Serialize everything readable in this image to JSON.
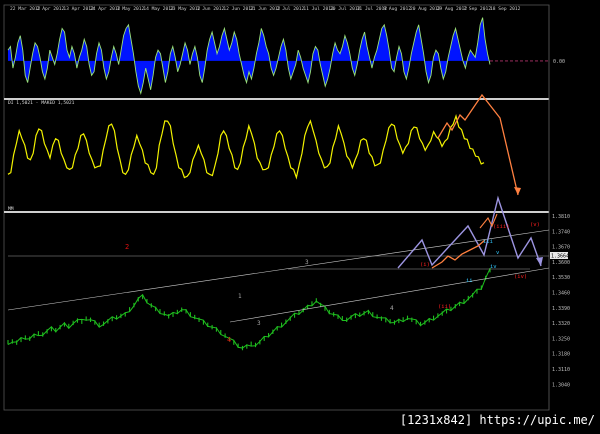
{
  "watermark": "[1231x842] https://upic.me/",
  "colors": {
    "background": "#000000",
    "histogram": "#0014ff",
    "histogram_outline": "#9be37a",
    "oscillator": "#f2f200",
    "price": "#1fbf1f",
    "projection_orange": "#ff8040",
    "projection_violet": "#9c94e0",
    "wave_red": "#e01010",
    "label_cyan": "#33c8ff"
  },
  "panel_labels": {
    "panel2": "DI 1,5021 - MAKED 1,5021",
    "panel3": "MM"
  },
  "chart_data": [
    {
      "type": "area",
      "name": "histogram-oscillator",
      "y_zero_label": "0.00",
      "series": [
        {
          "values": [
            0.3,
            0.4,
            -0.2,
            0.1,
            0.5,
            0.7,
            0.3,
            -0.4,
            -0.6,
            -0.2,
            0.2,
            0.5,
            0.4,
            0.1,
            -0.3,
            -0.5,
            -0.2,
            0.3,
            0.1,
            -0.1,
            0.2,
            0.6,
            0.9,
            0.8,
            0.3,
            0.1,
            0.4,
            0.2,
            -0.2,
            0.1,
            0.3,
            0.6,
            0.4,
            -0.1,
            -0.4,
            -0.3,
            0.2,
            0.5,
            0.3,
            -0.2,
            -0.5,
            -0.3,
            0.1,
            0.4,
            0.2,
            -0.1,
            0.3,
            0.7,
            0.9,
            1.0,
            0.6,
            0.2,
            -0.3,
            -0.7,
            -0.9,
            -0.6,
            -0.2,
            -0.5,
            -0.8,
            -0.4,
            0.1,
            0.3,
            0.2,
            -0.2,
            -0.6,
            -0.3,
            0.2,
            0.4,
            0.1,
            -0.3,
            -0.1,
            0.2,
            0.5,
            0.3,
            -0.1,
            0.2,
            0.4,
            0.1,
            -0.4,
            -0.6,
            -0.2,
            0.3,
            0.6,
            0.8,
            0.5,
            0.2,
            0.4,
            0.7,
            0.9,
            0.6,
            0.3,
            0.5,
            0.8,
            0.6,
            0.2,
            -0.1,
            -0.4,
            -0.6,
            -0.3,
            -0.5,
            -0.2,
            0.2,
            0.5,
            0.9,
            0.7,
            0.4,
            0.2,
            -0.2,
            -0.4,
            -0.2,
            0.1,
            0.4,
            0.6,
            0.3,
            -0.2,
            -0.5,
            -0.3,
            -0.1,
            0.3,
            0.1,
            -0.2,
            -0.4,
            -0.6,
            -0.3,
            0.2,
            0.4,
            0.3,
            -0.1,
            -0.4,
            -0.7,
            -0.5,
            -0.2,
            0.2,
            0.5,
            0.3,
            0.2,
            0.4,
            0.7,
            0.5,
            0.2,
            -0.2,
            -0.4,
            -0.1,
            0.3,
            0.6,
            0.8,
            0.4,
            0.1,
            -0.2,
            0.1,
            0.3,
            0.6,
            0.9,
            1.0,
            0.7,
            0.3,
            -0.2,
            -0.3,
            0.1,
            0.4,
            0.2,
            -0.3,
            -0.5,
            -0.2,
            0.2,
            0.5,
            0.8,
            1.0,
            0.6,
            0.2,
            -0.3,
            -0.6,
            -0.4,
            0.1,
            0.3,
            0.2,
            -0.2,
            -0.5,
            -0.3,
            0.1,
            0.4,
            0.7,
            0.9,
            0.6,
            0.3,
            0.0,
            -0.2,
            0.1,
            0.3,
            0.2,
            0.1,
            0.5,
            1.0,
            1.2,
            0.6,
            0.2,
            -0.1
          ]
        }
      ],
      "ylim": [
        -1.0,
        1.3
      ]
    },
    {
      "type": "line",
      "name": "yellow-oscillator",
      "series": [
        {
          "values": [
            30,
            35,
            50,
            65,
            75,
            70,
            60,
            50,
            45,
            55,
            70,
            80,
            75,
            65,
            55,
            50,
            60,
            70,
            65,
            55,
            45,
            40,
            35,
            40,
            50,
            60,
            70,
            75,
            65,
            55,
            45,
            40,
            38,
            42,
            55,
            70,
            80,
            85,
            75,
            60,
            45,
            35,
            30,
            38,
            50,
            62,
            70,
            65,
            55,
            45,
            40,
            35,
            30,
            40,
            60,
            75,
            85,
            88,
            80,
            65,
            50,
            40,
            35,
            30,
            28,
            35,
            45,
            55,
            60,
            55,
            45,
            35,
            30,
            32,
            40,
            55,
            70,
            78,
            70,
            60,
            50,
            40,
            35,
            45,
            58,
            70,
            80,
            75,
            62,
            50,
            42,
            38,
            35,
            40,
            50,
            62,
            72,
            78,
            70,
            60,
            48,
            40,
            35,
            30,
            40,
            55,
            70,
            82,
            85,
            78,
            65,
            55,
            45,
            40,
            38,
            45,
            58,
            70,
            80,
            75,
            62,
            52,
            45,
            40,
            45,
            55,
            65,
            70,
            65,
            55,
            48,
            42,
            40,
            45,
            55,
            68,
            78,
            85,
            80,
            70,
            60,
            55,
            58,
            65,
            75,
            82,
            78,
            70,
            62,
            58,
            60,
            68,
            74,
            72,
            66,
            62,
            64,
            70,
            78,
            85,
            90,
            82,
            76,
            70,
            66,
            60,
            56,
            52,
            48,
            44,
            42
          ]
        }
      ],
      "ylim": [
        0,
        100
      ]
    },
    {
      "type": "line",
      "name": "price-chart",
      "y_tick_labels": [
        "1.3810",
        "1.3740",
        "1.3670",
        "1.3600",
        "1.3530",
        "1.3460",
        "1.3390",
        "1.3320",
        "1.3250",
        "1.3180",
        "1.3110",
        "1.3040"
      ],
      "last_price_label": "1.3664",
      "series": [
        {
          "values": [
            1.3228,
            1.3232,
            1.3226,
            1.324,
            1.3252,
            1.3246,
            1.3262,
            1.3274,
            1.3268,
            1.3284,
            1.3296,
            1.329,
            1.3306,
            1.332,
            1.3312,
            1.3328,
            1.334,
            1.3334,
            1.335,
            1.3344,
            1.333,
            1.3318,
            1.3324,
            1.3336,
            1.3348,
            1.3356,
            1.3364,
            1.3372,
            1.3398,
            1.342,
            1.345,
            1.3462,
            1.344,
            1.3418,
            1.34,
            1.3388,
            1.3376,
            1.3362,
            1.337,
            1.3384,
            1.3396,
            1.3388,
            1.3372,
            1.3358,
            1.3344,
            1.333,
            1.3318,
            1.3306,
            1.3294,
            1.328,
            1.3262,
            1.3244,
            1.3226,
            1.321,
            1.3198,
            1.3206,
            1.322,
            1.3214,
            1.3228,
            1.3246,
            1.3264,
            1.3282,
            1.33,
            1.3318,
            1.3334,
            1.335,
            1.3366,
            1.338,
            1.3394,
            1.341,
            1.3428,
            1.3444,
            1.342,
            1.3402,
            1.3384,
            1.3372,
            1.336,
            1.3352,
            1.3344,
            1.3356,
            1.3364,
            1.337,
            1.3378,
            1.3384,
            1.3372,
            1.336,
            1.335,
            1.3342,
            1.3336,
            1.333,
            1.3338,
            1.3346,
            1.3354,
            1.3344,
            1.3332,
            1.3322,
            1.333,
            1.3342,
            1.3354,
            1.3366,
            1.3376,
            1.3388,
            1.34,
            1.3414,
            1.3426,
            1.344,
            1.3456,
            1.347,
            1.349,
            1.351,
            1.356,
            1.36
          ]
        }
      ],
      "wave_labels": [
        {
          "text": "2",
          "color": "red"
        },
        {
          "text": "3",
          "color": "gray"
        },
        {
          "text": "1",
          "color": "gray"
        },
        {
          "text": "3",
          "color": "gray"
        },
        {
          "text": "4",
          "color": "red"
        },
        {
          "text": "4",
          "color": "gray"
        },
        {
          "text": "(i)",
          "color": "red"
        },
        {
          "text": "(ii)",
          "color": "red"
        },
        {
          "text": "iii",
          "color": "cyan"
        },
        {
          "text": "v",
          "color": "cyan"
        },
        {
          "text": "iv",
          "color": "cyan"
        },
        {
          "text": "ii",
          "color": "cyan"
        },
        {
          "text": "(iii)",
          "color": "red"
        },
        {
          "text": "(iv)",
          "color": "red"
        },
        {
          "text": "(v)",
          "color": "red"
        }
      ]
    }
  ],
  "x_axis_dates": [
    "22 Mar 2012",
    "2 Apr 2012",
    "13 Apr 2012",
    "24 Apr 2012",
    "3 May 2012",
    "14 May 2012",
    "23 May 2012",
    "1 Jun 2012",
    "12 Jun 2012",
    "21 Jun 2012",
    "2 Jul 2012",
    "11 Jul 2012",
    "20 Jul 2012",
    "31 Jul 2012",
    "9 Aug 2012",
    "20 Aug 2012",
    "29 Aug 2012",
    "7 Sep 2012",
    "18 Sep 2012"
  ]
}
